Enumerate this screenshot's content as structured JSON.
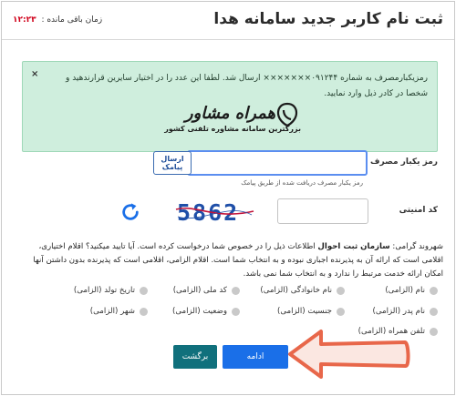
{
  "header": {
    "title": "ثبت نام کاربر جدید سامانه هدا",
    "timer_label": "زمان باقی مانده :",
    "timer_value": "۱۲:۲۳"
  },
  "alert": {
    "message": "رمزیکبارمصرف به شماره ۰۹۱۲۴۴××××××× ارسال شد. لطفا این عدد را در اختیار سایرین قرارندهید و شخصا در کادر ذیل وارد نمایید.",
    "close_glyph": "×"
  },
  "watermark": {
    "brand": "همراه مشاور",
    "tagline": "بزرگترین سامانه مشاوره تلفنی کشور"
  },
  "otp": {
    "label": "رمز یکبار مصرف",
    "value": "",
    "placeholder": "",
    "sms_button": "ارسال پیامک",
    "hint": "رمز یکبار مصرف دریافت شده از طریق پیامک"
  },
  "captcha": {
    "label": "کد امنیتی",
    "value": "",
    "image_text": "5862",
    "refresh_icon": "refresh-icon"
  },
  "consent": {
    "prefix": "شهروند گرامی: ",
    "org": "سازمان ثبت احوال",
    "body": " اطلاعات ذیل را در خصوص شما درخواست کرده است. آیا تایید میکنید؟ اقلام اختیاری، اقلامی است که ارائه آن به پذیرنده اجباری نبوده و به انتخاب شما است. اقلام الزامی، اقلامی است که پذیرنده بدون داشتن آنها امکان ارائه خدمت مرتبط را ندارد و به انتخاب شما نمی باشد."
  },
  "options": [
    {
      "label": "نام (الزامی)"
    },
    {
      "label": "نام خانوادگی (الزامی)"
    },
    {
      "label": "کد ملی (الزامی)"
    },
    {
      "label": "تاریخ تولد (الزامی)"
    },
    {
      "label": "نام پدر (الزامی)"
    },
    {
      "label": "جنسیت (الزامی)"
    },
    {
      "label": "وضعیت (الزامی)"
    },
    {
      "label": "شهر (الزامی)"
    },
    {
      "label": "تلفن همراه (الزامی)"
    }
  ],
  "actions": {
    "confirm": "ادامه",
    "back": "برگشت"
  },
  "colors": {
    "primary": "#1a6fe8",
    "back": "#10707c",
    "alert_bg": "#cfeedd",
    "timer": "#d0021b",
    "arrow": "#e8674a"
  }
}
